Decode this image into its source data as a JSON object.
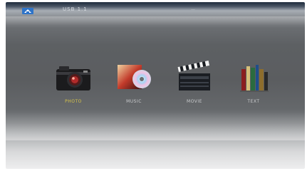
{
  "topbar": {
    "breadcrumb": "USB 1.1",
    "right_text": "—"
  },
  "menu": {
    "items": [
      {
        "label": "PHOTO",
        "icon": "camera-icon",
        "selected": true
      },
      {
        "label": "MUSIC",
        "icon": "music-disc-icon",
        "selected": false
      },
      {
        "label": "MOVIE",
        "icon": "clapperboard-icon",
        "selected": false
      },
      {
        "label": "TEXT",
        "icon": "books-icon",
        "selected": false
      }
    ]
  },
  "colors": {
    "selected_label": "#d7c44a",
    "label": "#c9cbcd"
  }
}
